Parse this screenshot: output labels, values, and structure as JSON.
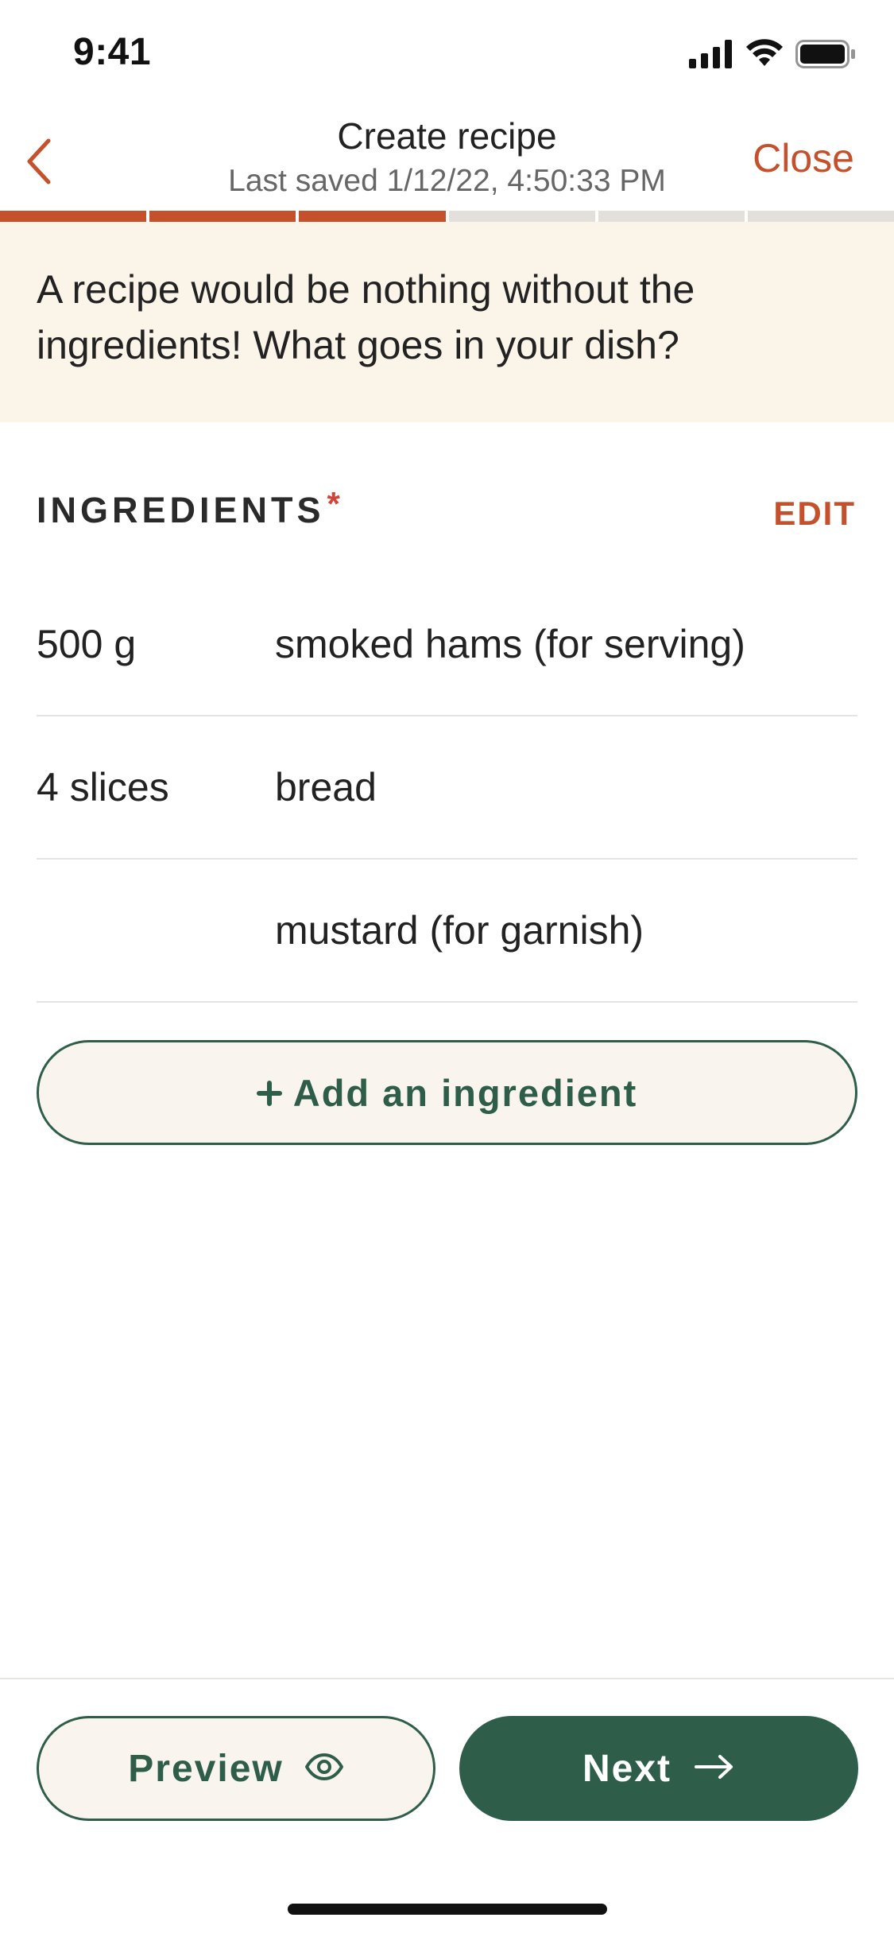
{
  "status_bar": {
    "time": "9:41",
    "icons": [
      "cellular-signal-icon",
      "wifi-icon",
      "battery-icon"
    ]
  },
  "header": {
    "back_icon": "chevron-left-icon",
    "title": "Create recipe",
    "subtitle": "Last saved 1/12/22, 4:50:33 PM",
    "close_label": "Close"
  },
  "progress": {
    "total_steps": 6,
    "completed_steps": 3
  },
  "banner": {
    "text": "A recipe would be nothing without the ingredients! What goes in your dish?"
  },
  "ingredients": {
    "title": "INGREDIENTS",
    "required_marker": "*",
    "edit_label": "EDIT",
    "items": [
      {
        "quantity": "500 g",
        "name": "smoked hams (for serving)"
      },
      {
        "quantity": "4 slices",
        "name": "bread"
      },
      {
        "quantity": "",
        "name": "mustard (for garnish)"
      }
    ],
    "add_label": "Add an ingredient",
    "add_icon": "plus-icon"
  },
  "footer": {
    "preview_label": "Preview",
    "preview_icon": "eye-icon",
    "next_label": "Next",
    "next_icon": "arrow-right-icon"
  },
  "colors": {
    "accent": "#C4512B",
    "primary": "#2E5E4A",
    "banner_bg": "#FBF4E9",
    "required": "#D0443A"
  }
}
